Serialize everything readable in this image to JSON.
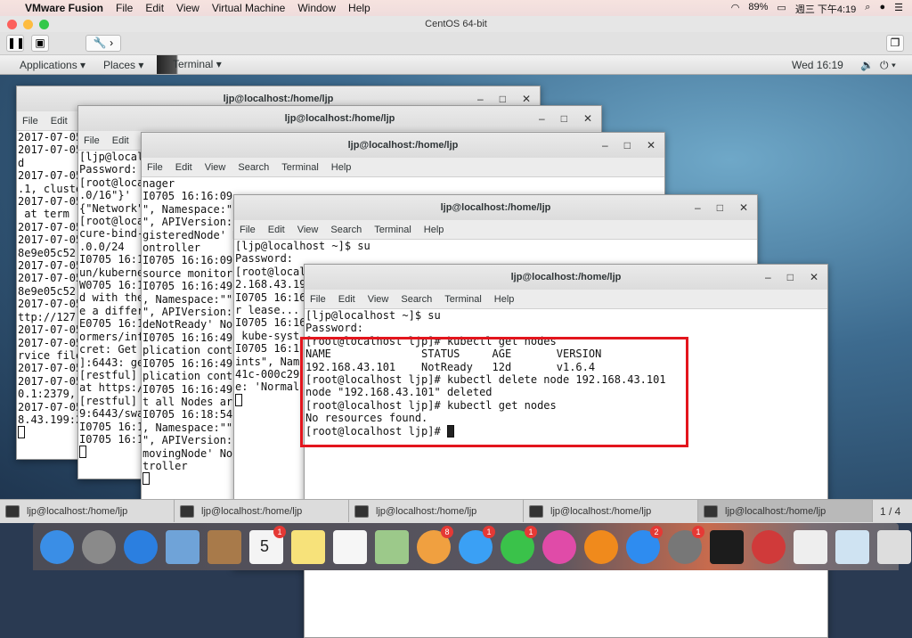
{
  "mac_menubar": {
    "app": "VMware Fusion",
    "menus": [
      "File",
      "Edit",
      "View",
      "Virtual Machine",
      "Window",
      "Help"
    ],
    "battery": "89%",
    "clock": "週三 下午4:19"
  },
  "vm": {
    "title": "CentOS 64-bit"
  },
  "gnome": {
    "applications": "Applications",
    "places": "Places",
    "terminal": "Terminal",
    "clock": "Wed 16:19"
  },
  "windows": [
    {
      "title": "ljp@localhost:/home/ljp",
      "menu": [
        "File",
        "Edit"
      ],
      "lines": [
        "2017-07-05",
        "2017-07-05",
        "d",
        "2017-07-05",
        ".1, cluste",
        "2017-07-05",
        " at term ",
        "2017-07-05",
        "2017-07-05",
        "8e9e05c52",
        "2017-07-05",
        "2017-07-05",
        "8e9e05c52",
        "2017-07-05",
        "ttp://127",
        "2017-07-05",
        "2017-07-05",
        "rvice file",
        "2017-07-05",
        "2017-07-05",
        "0.1:2379,",
        "2017-07-05",
        "8.43.199:2"
      ]
    },
    {
      "title": "ljp@localhost:/home/ljp",
      "menu": [
        "File",
        "Edit"
      ],
      "lines": [
        "[ljp@local",
        "Password:",
        "[root@loca",
        ".0/16\"}'",
        "{\"Network\"",
        "[root@loca",
        "cure-bind-",
        ".0.0/24",
        "I0705 16:1",
        "un/kuberne",
        "W0705 16:1",
        "d with the",
        "e a differ",
        "E0705 16:1",
        "ormers/inf",
        "cret: Get ",
        "]:6443: ge",
        "[restful] ",
        "at https:/",
        "[restful] ",
        "9:6443/swa",
        "I0705 16:1",
        "I0705 16:1"
      ]
    },
    {
      "title": "ljp@localhost:/home/ljp",
      "menu": [
        "File",
        "Edit",
        "View",
        "Search",
        "Terminal",
        "Help"
      ],
      "lines": [
        "nager",
        "I0705 16:16:09",
        "\", Namespace:\"\"",
        "\", APIVersion:",
        "gisteredNode' N",
        "ontroller",
        "I0705 16:16:09",
        "source monitor",
        "I0705 16:16:49",
        ", Namespace:\"\"",
        "\", APIVersion:",
        "deNotReady' No",
        "I0705 16:16:49",
        "plication cont",
        "I0705 16:16:49",
        "plication cont",
        "I0705 16:16:49",
        "t all Nodes ar",
        "I0705 16:18:54",
        ", Namespace:\"\"",
        "\", APIVersion:",
        "movingNode' No",
        "troller"
      ]
    },
    {
      "title": "ljp@localhost:/home/ljp",
      "menu": [
        "File",
        "Edit",
        "View",
        "Search",
        "Terminal",
        "Help"
      ],
      "lines": [
        "[ljp@localhost ~]$ su",
        "Password:",
        "[root@local",
        "2.168.43.19",
        "I0705 16:16",
        "r lease...",
        "I0705 16:16",
        " kube-syst",
        "I0705 16:1",
        "ints\", Nam",
        "41c-000c29",
        "e: 'Normal"
      ]
    },
    {
      "title": "ljp@localhost:/home/ljp",
      "menu": [
        "File",
        "Edit",
        "View",
        "Search",
        "Terminal",
        "Help"
      ],
      "lines": [
        "[ljp@localhost ~]$ su",
        "Password:",
        "[root@localhost ljp]# kubectl get nodes",
        "NAME              STATUS     AGE       VERSION",
        "192.168.43.101    NotReady   12d       v1.6.4",
        "[root@localhost ljp]# kubectl delete node 192.168.43.101",
        "node \"192.168.43.101\" deleted",
        "[root@localhost ljp]# kubectl get nodes",
        "No resources found.",
        "[root@localhost ljp]# "
      ]
    }
  ],
  "taskbar": {
    "items": [
      "ljp@localhost:/home/ljp",
      "ljp@localhost:/home/ljp",
      "ljp@localhost:/home/ljp",
      "ljp@localhost:/home/ljp",
      "ljp@localhost:/home/ljp"
    ],
    "active": 4,
    "pager": "1 / 4"
  },
  "dock": [
    {
      "name": "finder",
      "color": "#3a8ee6"
    },
    {
      "name": "launchpad",
      "color": "#8a8a8a"
    },
    {
      "name": "safari",
      "color": "#2b7fe0"
    },
    {
      "name": "mail",
      "color": "#6fa3d8"
    },
    {
      "name": "contacts",
      "color": "#a87a4a"
    },
    {
      "name": "calendar",
      "color": "#f4f4f4",
      "badge": "1",
      "label": "5"
    },
    {
      "name": "notes",
      "color": "#f7e27a"
    },
    {
      "name": "reminders",
      "color": "#f6f6f6"
    },
    {
      "name": "maps",
      "color": "#9cc98a"
    },
    {
      "name": "photos",
      "color": "#f0a040",
      "badge": "8"
    },
    {
      "name": "messages",
      "color": "#3aa0f5",
      "badge": "1"
    },
    {
      "name": "facetime",
      "color": "#3ac24a",
      "badge": "1"
    },
    {
      "name": "itunes",
      "color": "#e04ba8"
    },
    {
      "name": "ibooks",
      "color": "#f08a1c"
    },
    {
      "name": "app-store",
      "color": "#2e8cf0",
      "badge": "2"
    },
    {
      "name": "system-preferences",
      "color": "#777",
      "badge": "1"
    },
    {
      "name": "terminal",
      "color": "#1c1c1c"
    },
    {
      "name": "vmware-fusion",
      "color": "#d03a3a"
    },
    {
      "name": "textedit",
      "color": "#eee"
    },
    {
      "name": "downloads",
      "color": "#cfe3f2"
    },
    {
      "name": "trash",
      "color": "#ddd"
    }
  ]
}
